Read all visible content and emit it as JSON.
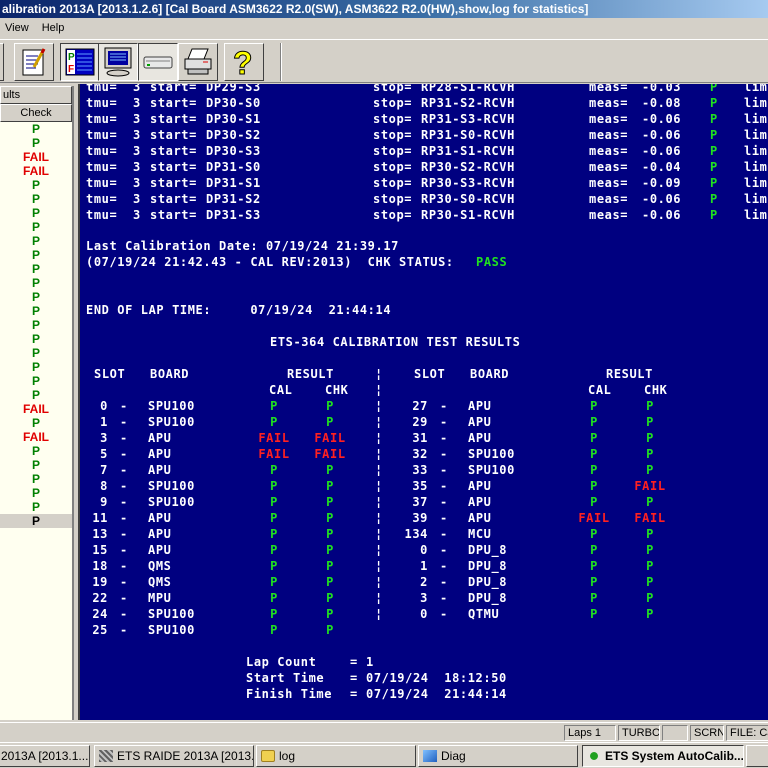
{
  "window": {
    "title": "alibration 2013A [2013.1.2.6]  [Cal Board ASM3622 R2.0(SW), ASM3622 R2.0(HW),show,log for statistics]"
  },
  "menu": [
    "View",
    "Help"
  ],
  "toolbar": {
    "buttons": [
      {
        "name": "edit-icon"
      },
      {
        "name": "pass-fail-icon",
        "pressed": true
      },
      {
        "name": "monitor-icon",
        "pressed": true
      },
      {
        "name": "scanner-icon",
        "pressed": true
      },
      {
        "name": "printer-icon"
      },
      {
        "name": "help-icon"
      }
    ]
  },
  "left_panel": {
    "header": "ults",
    "column": "Check",
    "rows": [
      "P",
      "P",
      "FAIL",
      "FAIL",
      "P",
      "P",
      "P",
      "P",
      "P",
      "P",
      "P",
      "P",
      "P",
      "P",
      "P",
      "P",
      "P",
      "P",
      "P",
      "P",
      "FAIL",
      "P",
      "FAIL",
      "P",
      "P",
      "P",
      "P",
      "P",
      "P"
    ],
    "selected_index": 28
  },
  "console": {
    "tmu_rows": [
      {
        "tmu": "3",
        "start": "DP29-S3",
        "stop": "RP28-S1-RCVH",
        "meas": "-0.03",
        "res": "P"
      },
      {
        "tmu": "3",
        "start": "DP30-S0",
        "stop": "RP31-S2-RCVH",
        "meas": "-0.08",
        "res": "P"
      },
      {
        "tmu": "3",
        "start": "DP30-S1",
        "stop": "RP31-S3-RCVH",
        "meas": "-0.06",
        "res": "P"
      },
      {
        "tmu": "3",
        "start": "DP30-S2",
        "stop": "RP31-S0-RCVH",
        "meas": "-0.06",
        "res": "P"
      },
      {
        "tmu": "3",
        "start": "DP30-S3",
        "stop": "RP31-S1-RCVH",
        "meas": "-0.06",
        "res": "P"
      },
      {
        "tmu": "3",
        "start": "DP31-S0",
        "stop": "RP30-S2-RCVH",
        "meas": "-0.04",
        "res": "P"
      },
      {
        "tmu": "3",
        "start": "DP31-S1",
        "stop": "RP30-S3-RCVH",
        "meas": "-0.09",
        "res": "P"
      },
      {
        "tmu": "3",
        "start": "DP31-S2",
        "stop": "RP30-S0-RCVH",
        "meas": "-0.06",
        "res": "P"
      },
      {
        "tmu": "3",
        "start": "DP31-S3",
        "stop": "RP30-S1-RCVH",
        "meas": "-0.06",
        "res": "P"
      }
    ],
    "labels": {
      "tmu": "tmu=",
      "start": "start=",
      "stop": "stop=",
      "meas": "meas=",
      "lim": "lim="
    },
    "last_cal": "Last Calibration Date: 07/19/24 21:39.17",
    "cal_rev": "(07/19/24 21:42.43 - CAL REV:2013)  CHK STATUS: ",
    "chk_status": "PASS",
    "end_lap": "END OF LAP TIME:     07/19/24  21:44:14",
    "results_title": "ETS-364 CALIBRATION TEST RESULTS",
    "headers": {
      "slot": "SLOT",
      "board": "BOARD",
      "result": "RESULT",
      "cal": "CAL",
      "chk": "CHK"
    },
    "left_table": [
      {
        "slot": "0",
        "board": "SPU100",
        "cal": "P",
        "chk": "P"
      },
      {
        "slot": "1",
        "board": "SPU100",
        "cal": "P",
        "chk": "P"
      },
      {
        "slot": "3",
        "board": "APU",
        "cal": "FAIL",
        "chk": "FAIL"
      },
      {
        "slot": "5",
        "board": "APU",
        "cal": "FAIL",
        "chk": "FAIL"
      },
      {
        "slot": "7",
        "board": "APU",
        "cal": "P",
        "chk": "P"
      },
      {
        "slot": "8",
        "board": "SPU100",
        "cal": "P",
        "chk": "P"
      },
      {
        "slot": "9",
        "board": "SPU100",
        "cal": "P",
        "chk": "P"
      },
      {
        "slot": "11",
        "board": "APU",
        "cal": "P",
        "chk": "P"
      },
      {
        "slot": "13",
        "board": "APU",
        "cal": "P",
        "chk": "P"
      },
      {
        "slot": "15",
        "board": "APU",
        "cal": "P",
        "chk": "P"
      },
      {
        "slot": "18",
        "board": "QMS",
        "cal": "P",
        "chk": "P"
      },
      {
        "slot": "19",
        "board": "QMS",
        "cal": "P",
        "chk": "P"
      },
      {
        "slot": "22",
        "board": "MPU",
        "cal": "P",
        "chk": "P"
      },
      {
        "slot": "24",
        "board": "SPU100",
        "cal": "P",
        "chk": "P"
      },
      {
        "slot": "25",
        "board": "SPU100",
        "cal": "P",
        "chk": "P"
      }
    ],
    "right_table": [
      {
        "slot": "27",
        "board": "APU",
        "cal": "P",
        "chk": "P"
      },
      {
        "slot": "29",
        "board": "APU",
        "cal": "P",
        "chk": "P"
      },
      {
        "slot": "31",
        "board": "APU",
        "cal": "P",
        "chk": "P"
      },
      {
        "slot": "32",
        "board": "SPU100",
        "cal": "P",
        "chk": "P"
      },
      {
        "slot": "33",
        "board": "SPU100",
        "cal": "P",
        "chk": "P"
      },
      {
        "slot": "35",
        "board": "APU",
        "cal": "P",
        "chk": "FAIL"
      },
      {
        "slot": "37",
        "board": "APU",
        "cal": "P",
        "chk": "P"
      },
      {
        "slot": "39",
        "board": "APU",
        "cal": "FAIL",
        "chk": "FAIL"
      },
      {
        "slot": "134",
        "board": "MCU",
        "cal": "P",
        "chk": "P"
      },
      {
        "slot": "0",
        "board": "DPU_8",
        "cal": "P",
        "chk": "P"
      },
      {
        "slot": "1",
        "board": "DPU_8",
        "cal": "P",
        "chk": "P"
      },
      {
        "slot": "2",
        "board": "DPU_8",
        "cal": "P",
        "chk": "P"
      },
      {
        "slot": "3",
        "board": "DPU_8",
        "cal": "P",
        "chk": "P"
      },
      {
        "slot": "0",
        "board": "QTMU",
        "cal": "P",
        "chk": "P"
      }
    ],
    "summary": [
      {
        "label": "Lap Count",
        "value": "1"
      },
      {
        "label": "Start Time",
        "value": "07/19/24  18:12:50"
      },
      {
        "label": "Finish Time",
        "value": "07/19/24  21:44:14"
      }
    ]
  },
  "statusbar": {
    "laps": "Laps 1",
    "turbo": "TURBO",
    "blank": "",
    "scrn": "SCRN",
    "file": "FILE: Ca"
  },
  "taskbar": [
    {
      "label": "2013A [2013.1...",
      "icon": "app-icon"
    },
    {
      "label": "ETS RAIDE 2013A [2013...",
      "icon": "raide-icon"
    },
    {
      "label": "log",
      "icon": "folder-icon"
    },
    {
      "label": "Diag",
      "icon": "diag-icon"
    },
    {
      "label": "ETS System AutoCalib...",
      "icon": "autocalib-icon",
      "active": true
    }
  ],
  "colors": {
    "console_bg": "#000080",
    "pass": "#20e020",
    "fail": "#ff2020",
    "list_pass": "#008000",
    "list_fail": "#e00000"
  }
}
